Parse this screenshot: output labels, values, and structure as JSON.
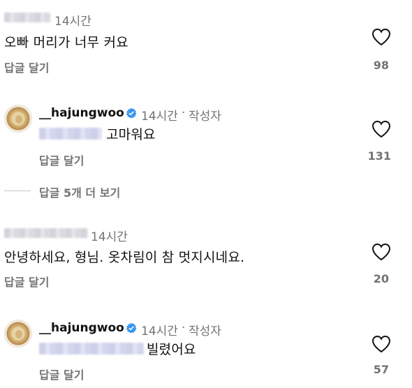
{
  "comments": [
    {
      "time": "14시간",
      "text": "오빠 머리가 너무 커요",
      "reply_label": "답글 달기",
      "likes": "98"
    },
    {
      "username": "__hajungwoo",
      "time": "14시간",
      "separator": "·",
      "author_badge": "작성자",
      "text": "고마워요",
      "reply_label": "답글 달기",
      "likes": "131"
    },
    {
      "view_more": "답글 5개 더 보기"
    },
    {
      "time": "14시간",
      "text": "안녕하세요, 형님. 옷차림이 참 멋지시네요.",
      "reply_label": "답글 달기",
      "likes": "20"
    },
    {
      "username": "__hajungwoo",
      "time": "14시간",
      "separator": "·",
      "author_badge": "작성자",
      "text": "빌렸어요",
      "reply_label": "답글 달기",
      "likes": "57"
    }
  ],
  "icons": {
    "like": "heart-outline-icon",
    "verified": "verified-badge-icon",
    "avatar": "profile-avatar"
  },
  "colors": {
    "text": "#111111",
    "muted": "#737373",
    "verified": "#3897f0"
  }
}
